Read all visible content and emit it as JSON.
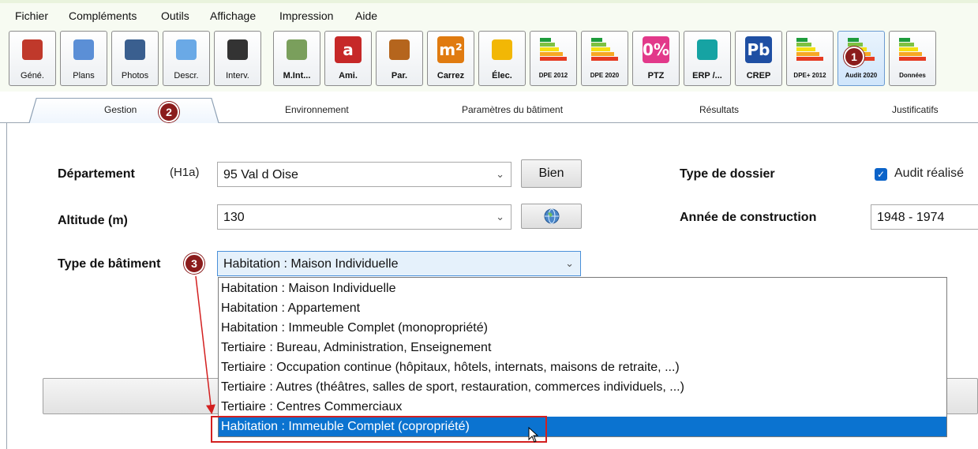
{
  "menu": [
    "Fichier",
    "Compléments",
    "Outils",
    "Affichage",
    "Impression",
    "Aide"
  ],
  "toolbar": [
    {
      "label": "Géné.",
      "icon": "house-icon",
      "color": "#c0392b"
    },
    {
      "label": "Plans",
      "icon": "plan-pencil-icon",
      "color": "#5b8fd6"
    },
    {
      "label": "Photos",
      "icon": "camera-icon",
      "color": "#3a5f8f"
    },
    {
      "label": "Descr.",
      "icon": "description-icon",
      "color": "#6aa9e6"
    },
    {
      "label": "Interv.",
      "icon": "telephone-icon",
      "color": "#333333"
    },
    {
      "label": "M.Int...",
      "icon": "contact-card-icon",
      "color": "#7a9f5c"
    },
    {
      "label": "Ami.",
      "icon": "asbestos-a-icon",
      "color": "#c62828",
      "glyph": "a"
    },
    {
      "label": "Par.",
      "icon": "termite-icon",
      "color": "#b5651d"
    },
    {
      "label": "Carrez",
      "icon": "square-meter-icon",
      "color": "#e07b10",
      "glyph": "m²"
    },
    {
      "label": "Élec.",
      "icon": "plug-icon",
      "color": "#f2b705"
    },
    {
      "label": "DPE 2012",
      "icon": "energy-label-icon",
      "color": "#2e9e44"
    },
    {
      "label": "DPE 2020",
      "icon": "energy-label-eu-icon",
      "color": "#2e9e44"
    },
    {
      "label": "PTZ",
      "icon": "zero-percent-icon",
      "color": "#e2398a",
      "glyph": "0%"
    },
    {
      "label": "ERP /...",
      "icon": "factory-icon",
      "color": "#16a3a3"
    },
    {
      "label": "CREP",
      "icon": "lead-pb-icon",
      "color": "#1f4fa3",
      "glyph": "Pb"
    },
    {
      "label": "DPE+ 2012",
      "icon": "energy-label-plus-icon",
      "color": "#2e9e44"
    },
    {
      "label": "Audit 2020",
      "icon": "audit-energy-icon",
      "color": "#2e9e44"
    },
    {
      "label": "Données",
      "icon": "energy-data-icon",
      "color": "#2e9e44"
    }
  ],
  "tabs": [
    "Gestion",
    "Environnement",
    "Paramètres du bâtiment",
    "Résultats",
    "Justificatifs"
  ],
  "form": {
    "departement_label": "Département",
    "zone": "(H1a)",
    "departement_value": "95  Val d Oise",
    "bien_button": "Bien",
    "altitude_label": "Altitude (m)",
    "altitude_value": "130",
    "type_batiment_label": "Type de bâtiment",
    "type_batiment_value": "Habitation : Maison Individuelle",
    "type_dossier_label": "Type de dossier",
    "audit_checkbox_label": "Audit réalisé",
    "annee_label": "Année de construction",
    "annee_value": "1948 - 1974"
  },
  "dropdown_options": [
    "Habitation : Maison Individuelle",
    "Habitation : Appartement",
    "Habitation : Immeuble Complet (monopropriété)",
    "Tertiaire : Bureau, Administration, Enseignement",
    "Tertiaire : Occupation continue (hôpitaux, hôtels, internats, maisons de retraite, ...)",
    "Tertiaire : Autres (théâtres, salles de sport, restauration, commerces individuels, ...)",
    "Tertiaire : Centres Commerciaux",
    "Habitation : Immeuble Complet (copropriété)"
  ],
  "badges": [
    "1",
    "2",
    "3"
  ],
  "colors": {
    "accent": "#0b73d0",
    "badge": "#8b1c1c",
    "highlight": "#d32020"
  }
}
